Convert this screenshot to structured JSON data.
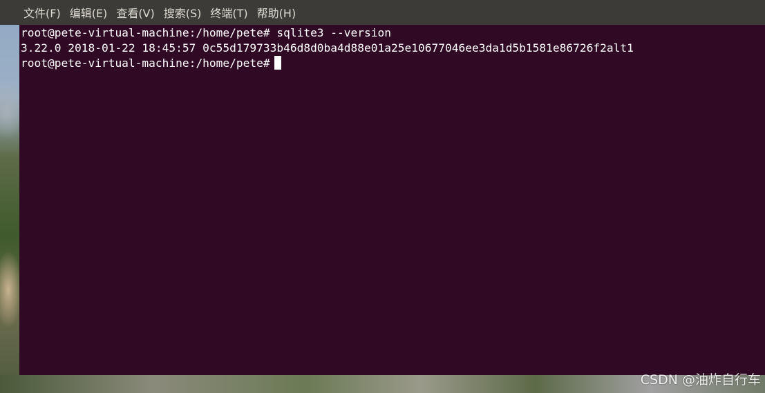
{
  "menubar": {
    "items": [
      {
        "label": "文件(F)"
      },
      {
        "label": "编辑(E)"
      },
      {
        "label": "查看(V)"
      },
      {
        "label": "搜索(S)"
      },
      {
        "label": "终端(T)"
      },
      {
        "label": "帮助(H)"
      }
    ]
  },
  "terminal": {
    "lines": [
      "root@pete-virtual-machine:/home/pete# sqlite3 --version",
      "3.22.0 2018-01-22 18:45:57 0c55d179733b46d8d0ba4d88e01a25e10677046ee3da1d5b1581e86726f2alt1",
      "root@pete-virtual-machine:/home/pete#"
    ]
  },
  "watermark": {
    "text": "CSDN @油炸自行车"
  },
  "colors": {
    "menubar_bg": "#3c3b37",
    "terminal_bg": "#300a24",
    "terminal_text": "#ffffff"
  }
}
